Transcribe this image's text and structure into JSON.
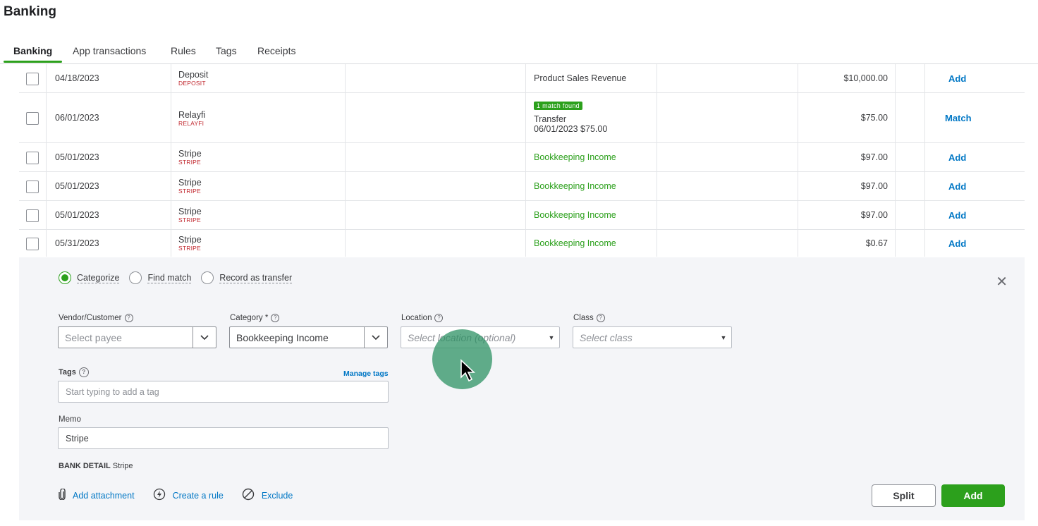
{
  "page_title": "Banking",
  "tabs": [
    {
      "label": "Banking",
      "active": true
    },
    {
      "label": "App transactions"
    },
    {
      "label": "Rules"
    },
    {
      "label": "Tags"
    },
    {
      "label": "Receipts"
    }
  ],
  "rows": [
    {
      "date": "04/18/2023",
      "name": "Deposit",
      "sub": "DEPOSIT",
      "category": "Product Sales Revenue",
      "amount": "$10,000.00",
      "action": "Add"
    },
    {
      "date": "06/01/2023",
      "name": "Relayfi",
      "sub": "RELAYFI",
      "match_badge": "1 match found",
      "category_line1": "Transfer",
      "category_line2": "06/01/2023 $75.00",
      "amount": "$75.00",
      "action": "Match"
    },
    {
      "date": "05/01/2023",
      "name": "Stripe",
      "sub": "STRIPE",
      "category": "Bookkeeping Income",
      "amount": "$97.00",
      "action": "Add"
    },
    {
      "date": "05/01/2023",
      "name": "Stripe",
      "sub": "STRIPE",
      "category": "Bookkeeping Income",
      "amount": "$97.00",
      "action": "Add"
    },
    {
      "date": "05/01/2023",
      "name": "Stripe",
      "sub": "STRIPE",
      "category": "Bookkeeping Income",
      "amount": "$97.00",
      "action": "Add"
    },
    {
      "date": "05/31/2023",
      "name": "Stripe",
      "sub": "STRIPE",
      "category": "Bookkeeping Income",
      "amount": "$0.67",
      "action": "Add"
    }
  ],
  "detail": {
    "radio": {
      "categorize": "Categorize",
      "find_match": "Find match",
      "record_transfer": "Record as transfer"
    },
    "vendor_label": "Vendor/Customer",
    "vendor_placeholder": "Select payee",
    "category_label": "Category *",
    "category_value": "Bookkeeping Income",
    "location_label": "Location",
    "location_placeholder": "Select location (optional)",
    "class_label": "Class",
    "class_placeholder": "Select class",
    "tags_label": "Tags",
    "manage_tags": "Manage tags",
    "tags_placeholder": "Start typing to add a tag",
    "memo_label": "Memo",
    "memo_value": "Stripe",
    "bank_detail_label": "BANK DETAIL",
    "bank_detail_value": "Stripe",
    "add_attachment": "Add attachment",
    "create_rule": "Create a rule",
    "exclude": "Exclude",
    "split_button": "Split",
    "add_button": "Add"
  },
  "colors": {
    "accent": "#2ca01c",
    "link": "#0077c5",
    "sub_red": "#c0262d"
  }
}
